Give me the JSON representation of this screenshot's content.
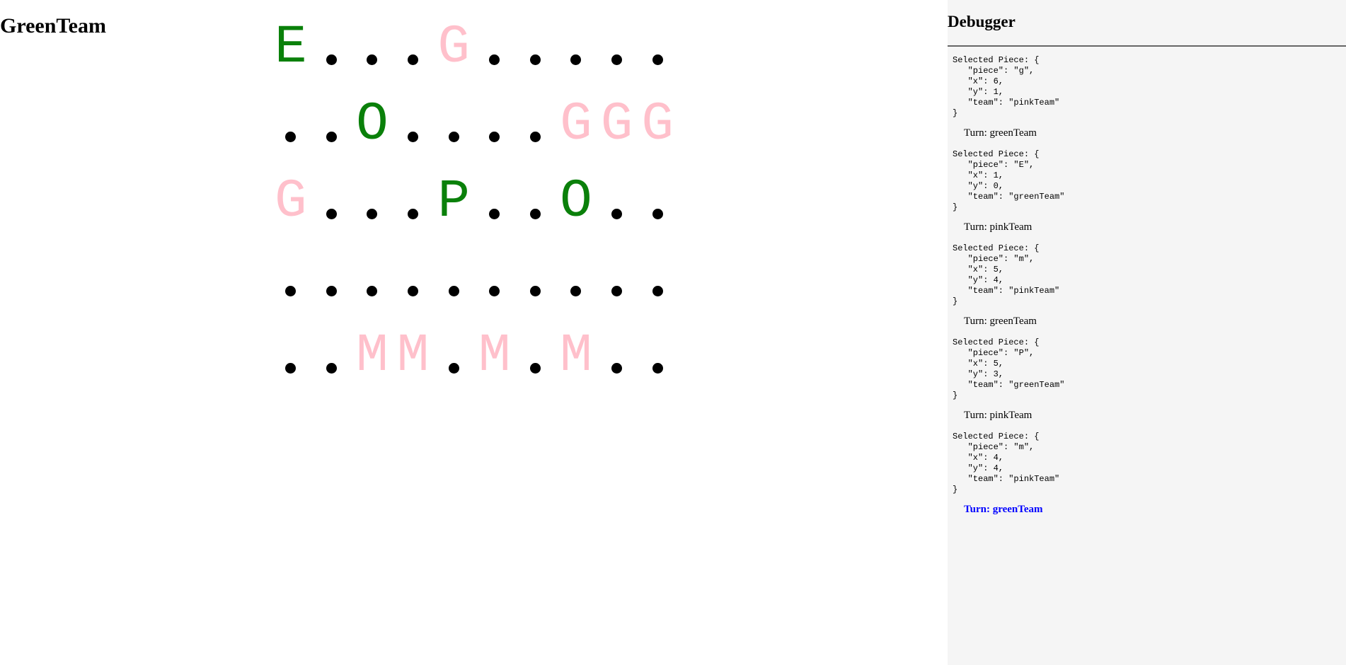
{
  "header": {
    "team": "GreenTeam"
  },
  "board": {
    "rows": [
      [
        {
          "t": "E",
          "team": "green"
        },
        {
          "t": ".",
          "team": null
        },
        {
          "t": ".",
          "team": null
        },
        {
          "t": ".",
          "team": null
        },
        {
          "t": "G",
          "team": "pink"
        },
        {
          "t": ".",
          "team": null
        },
        {
          "t": ".",
          "team": null
        },
        {
          "t": ".",
          "team": null
        },
        {
          "t": ".",
          "team": null
        },
        {
          "t": ".",
          "team": null
        }
      ],
      [
        {
          "t": ".",
          "team": null
        },
        {
          "t": ".",
          "team": null
        },
        {
          "t": "O",
          "team": "green"
        },
        {
          "t": ".",
          "team": null
        },
        {
          "t": ".",
          "team": null
        },
        {
          "t": ".",
          "team": null
        },
        {
          "t": ".",
          "team": null
        },
        {
          "t": "G",
          "team": "pink"
        },
        {
          "t": "G",
          "team": "pink"
        },
        {
          "t": "G",
          "team": "pink"
        }
      ],
      [
        {
          "t": "G",
          "team": "pink"
        },
        {
          "t": ".",
          "team": null
        },
        {
          "t": ".",
          "team": null
        },
        {
          "t": ".",
          "team": null
        },
        {
          "t": "P",
          "team": "green"
        },
        {
          "t": ".",
          "team": null
        },
        {
          "t": ".",
          "team": null
        },
        {
          "t": "O",
          "team": "green"
        },
        {
          "t": ".",
          "team": null
        },
        {
          "t": ".",
          "team": null
        }
      ],
      [
        {
          "t": ".",
          "team": null
        },
        {
          "t": ".",
          "team": null
        },
        {
          "t": ".",
          "team": null
        },
        {
          "t": ".",
          "team": null
        },
        {
          "t": ".",
          "team": null
        },
        {
          "t": ".",
          "team": null
        },
        {
          "t": ".",
          "team": null
        },
        {
          "t": ".",
          "team": null
        },
        {
          "t": ".",
          "team": null
        },
        {
          "t": ".",
          "team": null
        }
      ],
      [
        {
          "t": ".",
          "team": null
        },
        {
          "t": ".",
          "team": null
        },
        {
          "t": "M",
          "team": "pink"
        },
        {
          "t": "M",
          "team": "pink"
        },
        {
          "t": ".",
          "team": null
        },
        {
          "t": "M",
          "team": "pink"
        },
        {
          "t": ".",
          "team": null
        },
        {
          "t": "M",
          "team": "pink"
        },
        {
          "t": ".",
          "team": null
        },
        {
          "t": ".",
          "team": null
        }
      ]
    ],
    "colors": {
      "green": "#0a800a",
      "pink": "#ffc0cb",
      "empty": "#000000"
    }
  },
  "debugger": {
    "title": "Debugger",
    "entries": [
      {
        "selected": "Selected Piece: {\n   \"piece\": \"g\",\n   \"x\": 6,\n   \"y\": 1,\n   \"team\": \"pinkTeam\"\n}",
        "turn": "Turn: greenTeam",
        "current": false
      },
      {
        "selected": "Selected Piece: {\n   \"piece\": \"E\",\n   \"x\": 1,\n   \"y\": 0,\n   \"team\": \"greenTeam\"\n}",
        "turn": "Turn: pinkTeam",
        "current": false
      },
      {
        "selected": "Selected Piece: {\n   \"piece\": \"m\",\n   \"x\": 5,\n   \"y\": 4,\n   \"team\": \"pinkTeam\"\n}",
        "turn": "Turn: greenTeam",
        "current": false
      },
      {
        "selected": "Selected Piece: {\n   \"piece\": \"P\",\n   \"x\": 5,\n   \"y\": 3,\n   \"team\": \"greenTeam\"\n}",
        "turn": "Turn: pinkTeam",
        "current": false
      },
      {
        "selected": "Selected Piece: {\n   \"piece\": \"m\",\n   \"x\": 4,\n   \"y\": 4,\n   \"team\": \"pinkTeam\"\n}",
        "turn": "Turn: greenTeam",
        "current": true
      }
    ],
    "current_turn_color": "#0000ff"
  }
}
